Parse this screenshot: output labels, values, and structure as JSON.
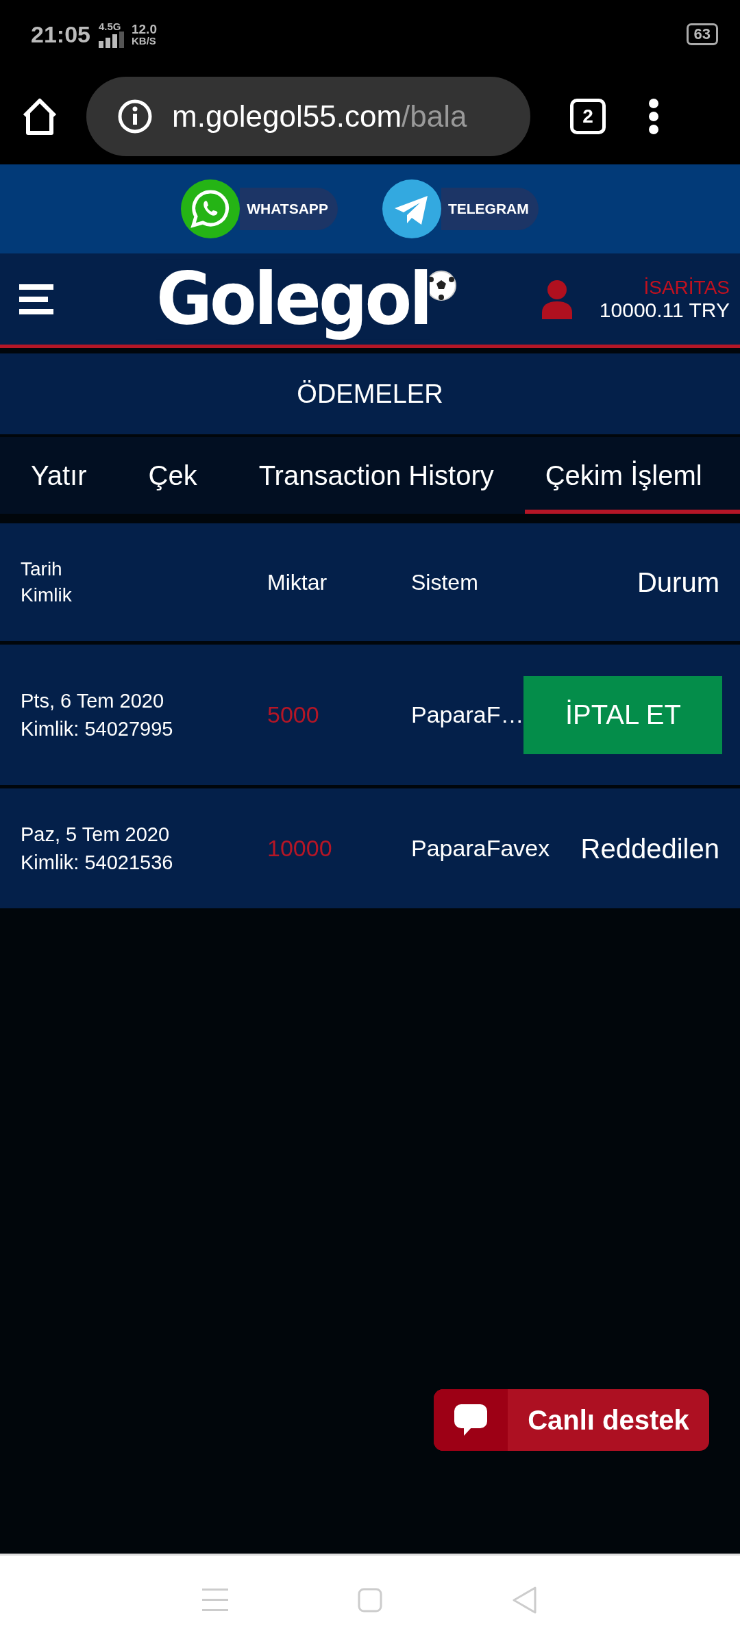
{
  "status_bar": {
    "time": "21:05",
    "network": "4.5G",
    "speed": "12.0",
    "speed_unit": "KB/S",
    "battery": "63"
  },
  "browser": {
    "url_host": "m.golegol55.com",
    "url_path": "/bala",
    "tab_count": "2"
  },
  "social": [
    {
      "kind": "whatsapp",
      "label": "WHATSAPP"
    },
    {
      "kind": "telegram",
      "label": "TELEGRAM"
    }
  ],
  "header": {
    "logo": "Golegol",
    "username": "İSARİTAS",
    "balance": "10000.11 TRY"
  },
  "page_title": "ÖDEMELER",
  "tabs": [
    {
      "label": "Yatır",
      "selected": false
    },
    {
      "label": "Çek",
      "selected": false
    },
    {
      "label": "Transaction History",
      "selected": false
    },
    {
      "label": "Çekim İşleml",
      "selected": true
    }
  ],
  "table": {
    "columns": [
      [
        "Tarih",
        "Kimlik"
      ],
      "Miktar",
      "Sistem",
      "Durum"
    ],
    "rows": [
      {
        "date": "Pts, 6 Tem 2020",
        "id": "Kimlik: 54027995",
        "amount": "5000",
        "system": "PaparaF…",
        "status": {
          "kind": "button",
          "label": "İPTAL ET"
        }
      },
      {
        "date": "Paz, 5 Tem 2020",
        "id": "Kimlik: 54021536",
        "amount": "10000",
        "system": "PaparaFavex",
        "status": {
          "kind": "text",
          "label": "Reddedilen"
        }
      }
    ]
  },
  "chat_button": {
    "label": "Canlı destek"
  }
}
